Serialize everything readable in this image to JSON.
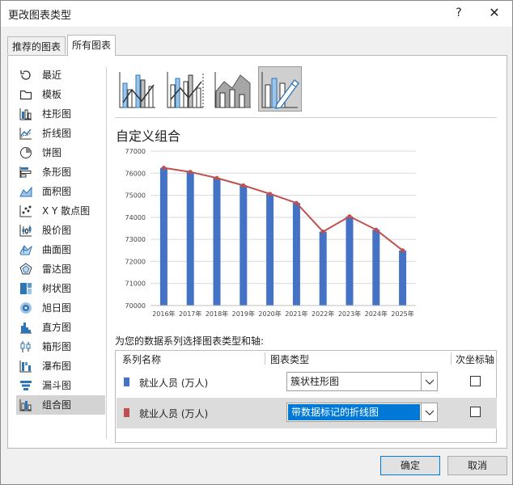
{
  "window": {
    "title": "更改图表类型",
    "help_label": "?",
    "close_label": "✕"
  },
  "tabs": [
    {
      "label": "推荐的图表",
      "active": false
    },
    {
      "label": "所有图表",
      "active": true
    }
  ],
  "nav": {
    "items": [
      {
        "label": "最近",
        "icon": "recent-icon"
      },
      {
        "label": "模板",
        "icon": "template-icon"
      },
      {
        "label": "柱形图",
        "icon": "column-chart-icon"
      },
      {
        "label": "折线图",
        "icon": "line-chart-icon"
      },
      {
        "label": "饼图",
        "icon": "pie-chart-icon"
      },
      {
        "label": "条形图",
        "icon": "bar-chart-icon"
      },
      {
        "label": "面积图",
        "icon": "area-chart-icon"
      },
      {
        "label": "X Y 散点图",
        "icon": "scatter-chart-icon"
      },
      {
        "label": "股价图",
        "icon": "stock-chart-icon"
      },
      {
        "label": "曲面图",
        "icon": "surface-chart-icon"
      },
      {
        "label": "雷达图",
        "icon": "radar-chart-icon"
      },
      {
        "label": "树状图",
        "icon": "treemap-chart-icon"
      },
      {
        "label": "旭日图",
        "icon": "sunburst-chart-icon"
      },
      {
        "label": "直方图",
        "icon": "histogram-chart-icon"
      },
      {
        "label": "箱形图",
        "icon": "box-whisker-chart-icon"
      },
      {
        "label": "瀑布图",
        "icon": "waterfall-chart-icon"
      },
      {
        "label": "漏斗图",
        "icon": "funnel-chart-icon"
      },
      {
        "label": "组合图",
        "icon": "combo-chart-icon"
      }
    ],
    "selected_index": 17
  },
  "subtypes": [
    {
      "name": "clustered-column-line",
      "selected": false
    },
    {
      "name": "clustered-column-line-secondary-axis",
      "selected": false
    },
    {
      "name": "stacked-area-clustered-column",
      "selected": false
    },
    {
      "name": "custom-combination",
      "selected": true
    }
  ],
  "preview": {
    "title": "自定义组合"
  },
  "chart_data": {
    "type": "bar",
    "categories": [
      "2016年",
      "2017年",
      "2018年",
      "2019年",
      "2020年",
      "2021年",
      "2022年",
      "2023年",
      "2024年",
      "2025年"
    ],
    "series": [
      {
        "type": "bar",
        "color": "#4472c4",
        "values": [
          76245,
          76058,
          75782,
          75447,
          75064,
          74652,
          73351,
          74041,
          73439,
          72500
        ]
      },
      {
        "type": "line",
        "color": "#c0504d",
        "marker": true,
        "values": [
          76245,
          76058,
          75782,
          75447,
          75064,
          74652,
          73351,
          74041,
          73439,
          72500
        ]
      }
    ],
    "ylim": [
      70000,
      77000
    ],
    "yticks": [
      "70000",
      "71000",
      "72000",
      "73000",
      "74000",
      "75000",
      "76000",
      "77000"
    ],
    "grid": true
  },
  "series_table": {
    "prompt": "为您的数据系列选择图表类型和轴:",
    "headers": {
      "name": "系列名称",
      "type": "图表类型",
      "secondary": "次坐标轴"
    },
    "rows": [
      {
        "name": "就业人员 (万人)",
        "color": "#4472c4",
        "chart_type": "簇状柱形图",
        "secondary": false,
        "selected": false
      },
      {
        "name": "就业人员 (万人)",
        "color": "#c0504d",
        "chart_type": "带数据标记的折线图",
        "secondary": false,
        "selected": true
      }
    ]
  },
  "buttons": {
    "ok": "确定",
    "cancel": "取消"
  }
}
